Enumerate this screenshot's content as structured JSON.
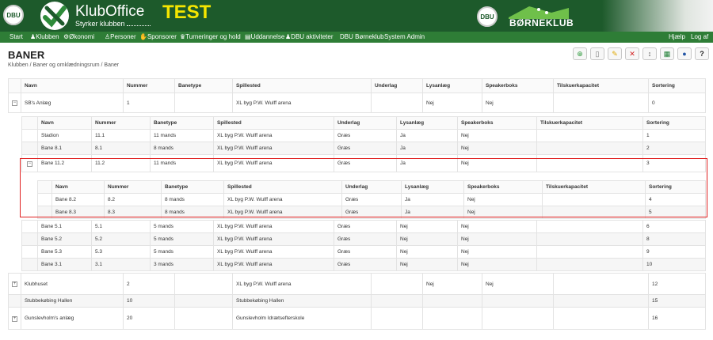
{
  "header": {
    "seal_left_text": "DBU",
    "brand": "KlubOffice",
    "tagline": "Styrker klubben",
    "environment_badge": "TEST",
    "seal_right_text": "DBU",
    "partner_logo_text": "BØRNEKLUB"
  },
  "nav": {
    "items": [
      {
        "label": "Start",
        "icon": "none"
      },
      {
        "label": "Klubben",
        "icon": "people-icon"
      },
      {
        "label": "Økonomi",
        "icon": "gear-icon"
      },
      {
        "label": "Personer",
        "icon": "person-icon"
      },
      {
        "label": "Sponsorer",
        "icon": "handshake-icon"
      },
      {
        "label": "Turneringer og hold",
        "icon": "trophy-icon"
      },
      {
        "label": "Uddannelse",
        "icon": "book-icon"
      },
      {
        "label": "DBU aktiviteter",
        "icon": "people-icon"
      },
      {
        "label": "DBU Børneklub",
        "icon": "none"
      },
      {
        "label": "System Admin",
        "icon": "none"
      }
    ],
    "help": "Hjælp",
    "logout": "Log af"
  },
  "page": {
    "title": "BANER",
    "breadcrumb": "Klubben / Baner og omklædningsrum / Baner"
  },
  "toolbar": {
    "buttons": [
      {
        "name": "add",
        "icon": "plus-circle-icon",
        "color": "#2e9a3c"
      },
      {
        "name": "new",
        "icon": "new-document-icon",
        "color": "#777777"
      },
      {
        "name": "edit",
        "icon": "edit-document-icon",
        "color": "#e0a800"
      },
      {
        "name": "delete",
        "icon": "close-icon",
        "color": "#d32020"
      },
      {
        "name": "sort",
        "icon": "sort-icon",
        "color": "#555555"
      },
      {
        "name": "excel",
        "icon": "excel-icon",
        "color": "#1e7e34"
      },
      {
        "name": "settings",
        "icon": "globe-icon",
        "color": "#2456a6"
      },
      {
        "name": "help",
        "icon": "question-icon",
        "color": "#222222"
      }
    ]
  },
  "columns": [
    "Navn",
    "Nummer",
    "Banetype",
    "Spillested",
    "Underlag",
    "Lysanlæg",
    "Speakerboks",
    "Tilskuerkapacitet",
    "Sortering"
  ],
  "main_rows": [
    {
      "name": "SB's Anlæg",
      "number": "1",
      "type": "",
      "venue": "XL byg P.W. Wulff arena",
      "surface": "",
      "lights": "Nej",
      "speaker": "Nej",
      "capacity": "",
      "sort": "0"
    },
    {
      "name": "Klubhuset",
      "number": "2",
      "type": "",
      "venue": "XL byg P.W. Wulff arena",
      "surface": "",
      "lights": "Nej",
      "speaker": "Nej",
      "capacity": "",
      "sort": "12"
    },
    {
      "name": "Stubbekøbing Hallen",
      "number": "10",
      "type": "",
      "venue": "Stubbekøbing Hallen",
      "surface": "",
      "lights": "",
      "speaker": "",
      "capacity": "",
      "sort": "15"
    },
    {
      "name": "Gunslevholm's anlæg",
      "number": "20",
      "type": "",
      "venue": "Gunslevholm Idrætsefterskole",
      "surface": "",
      "lights": "",
      "speaker": "",
      "capacity": "",
      "sort": "16"
    }
  ],
  "sub_rows": [
    {
      "name": "Stadion",
      "number": "11.1",
      "type": "11 mands",
      "venue": "XL byg P.W. Wulff arena",
      "surface": "Græs",
      "lights": "Ja",
      "speaker": "Nej",
      "capacity": "",
      "sort": "1"
    },
    {
      "name": "Bane 8.1",
      "number": "8.1",
      "type": "8 mands",
      "venue": "XL byg P.W. Wulff arena",
      "surface": "Græs",
      "lights": "Ja",
      "speaker": "Nej",
      "capacity": "",
      "sort": "2"
    },
    {
      "name": "Bane 11.2",
      "number": "11.2",
      "type": "11 mands",
      "venue": "XL byg P.W. Wulff arena",
      "surface": "Græs",
      "lights": "Ja",
      "speaker": "Nej",
      "capacity": "",
      "sort": "3"
    },
    {
      "name": "Bane 5.1",
      "number": "5.1",
      "type": "5 mands",
      "venue": "XL byg P.W. Wulff arena",
      "surface": "Græs",
      "lights": "Nej",
      "speaker": "Nej",
      "capacity": "",
      "sort": "6"
    },
    {
      "name": "Bane 5.2",
      "number": "5.2",
      "type": "5 mands",
      "venue": "XL byg P.W. Wulff arena",
      "surface": "Græs",
      "lights": "Nej",
      "speaker": "Nej",
      "capacity": "",
      "sort": "8"
    },
    {
      "name": "Bane 5.3",
      "number": "5.3",
      "type": "5 mands",
      "venue": "XL byg P.W. Wulff arena",
      "surface": "Græs",
      "lights": "Nej",
      "speaker": "Nej",
      "capacity": "",
      "sort": "9"
    },
    {
      "name": "Bane 3.1",
      "number": "3.1",
      "type": "3 mands",
      "venue": "XL byg P.W. Wulff arena",
      "surface": "Græs",
      "lights": "Nej",
      "speaker": "Nej",
      "capacity": "",
      "sort": "10"
    }
  ],
  "sub_sub_rows": [
    {
      "name": "Bane 8.2",
      "number": "8.2",
      "type": "8 mands",
      "venue": "XL byg P.W. Wulff arena",
      "surface": "Græs",
      "lights": "Ja",
      "speaker": "Nej",
      "capacity": "",
      "sort": "4"
    },
    {
      "name": "Bane 8.3",
      "number": "8.3",
      "type": "8 mands",
      "venue": "XL byg P.W. Wulff arena",
      "surface": "Græs",
      "lights": "Ja",
      "speaker": "Nej",
      "capacity": "",
      "sort": "5"
    }
  ],
  "highlight_color": "#e02020"
}
